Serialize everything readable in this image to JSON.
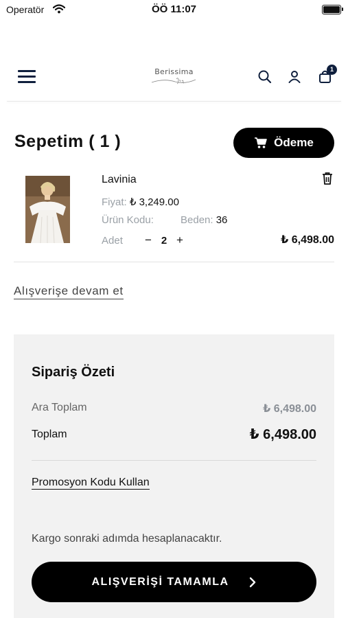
{
  "status_bar": {
    "carrier": "Operatör",
    "time": "ÖÖ 11:07"
  },
  "header": {
    "brand": "Berissima",
    "brand_script": "Bride",
    "cart_count": "1"
  },
  "cart": {
    "title": "Sepetim ( 1 )",
    "checkout_label": "Ödeme"
  },
  "item": {
    "name": "Lavinia",
    "price_label": "Fiyat:",
    "price_value": "₺ 3,249.00",
    "code_label": "Ürün Kodu:",
    "code_value": "",
    "size_label": "Beden:",
    "size_value": "36",
    "qty_label": "Adet",
    "qty_minus": "−",
    "qty_value": "2",
    "qty_plus": "+",
    "line_total": "₺ 6,498.00"
  },
  "continue_label": "Alışverişe devam et",
  "summary": {
    "title": "Sipariş Özeti",
    "subtotal_label": "Ara Toplam",
    "subtotal_value": "₺ 6,498.00",
    "total_label": "Toplam",
    "total_value": "₺ 6,498.00",
    "promo_label": "Promosyon Kodu Kullan",
    "shipping_note": "Kargo sonraki adımda hesaplanacaktır.",
    "complete_label": "ALIŞVERİŞİ TAMAMLA"
  },
  "icons": [
    "menu-icon",
    "search-icon",
    "user-icon",
    "bag-icon",
    "cart-icon",
    "trash-icon",
    "chevron-right-icon",
    "wifi-icon",
    "battery-icon"
  ],
  "colors": {
    "primary": "#000000",
    "navy": "#0f1f3d",
    "summary_bg": "#f2f2f2",
    "muted": "#9aa0a6"
  }
}
